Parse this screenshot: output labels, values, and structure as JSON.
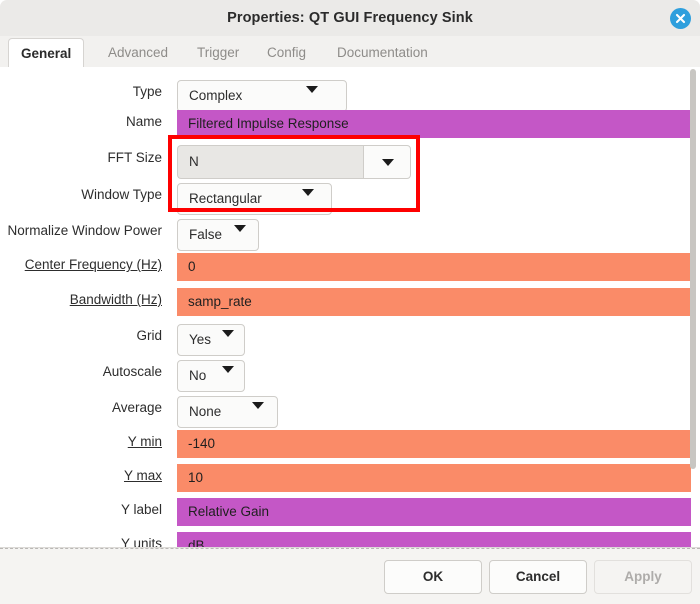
{
  "window": {
    "title": "Properties: QT GUI Frequency Sink",
    "close_icon": "close-icon"
  },
  "tabs": [
    {
      "label": "General",
      "active": true
    },
    {
      "label": "Advanced",
      "active": false
    },
    {
      "label": "Trigger",
      "active": false
    },
    {
      "label": "Config",
      "active": false
    },
    {
      "label": "Documentation",
      "active": false
    }
  ],
  "fields": {
    "type": {
      "label": "Type",
      "value": "Complex"
    },
    "name": {
      "label": "Name",
      "value": "Filtered Impulse Response"
    },
    "fft_size": {
      "label": "FFT Size",
      "value": "N"
    },
    "window_type": {
      "label": "Window Type",
      "value": "Rectangular"
    },
    "normalize": {
      "label": "Normalize Window Power",
      "value": "False"
    },
    "center_freq": {
      "label": "Center Frequency (Hz)",
      "value": "0"
    },
    "bandwidth": {
      "label": "Bandwidth (Hz)",
      "value": "samp_rate"
    },
    "grid": {
      "label": "Grid",
      "value": "Yes"
    },
    "autoscale": {
      "label": "Autoscale",
      "value": "No"
    },
    "average": {
      "label": "Average",
      "value": "None"
    },
    "y_min": {
      "label": "Y min",
      "value": "-140"
    },
    "y_max": {
      "label": "Y max",
      "value": "10"
    },
    "y_label": {
      "label": "Y label",
      "value": "Relative Gain"
    },
    "y_units": {
      "label": "Y units",
      "value": "dB"
    }
  },
  "footer": {
    "ok": "OK",
    "cancel": "Cancel",
    "apply": "Apply"
  },
  "colors": {
    "magenta_field": "#C457C6",
    "orange_field": "#FA8B68",
    "highlight_box": "#FE0000",
    "close_button": "#2E9FDD"
  }
}
